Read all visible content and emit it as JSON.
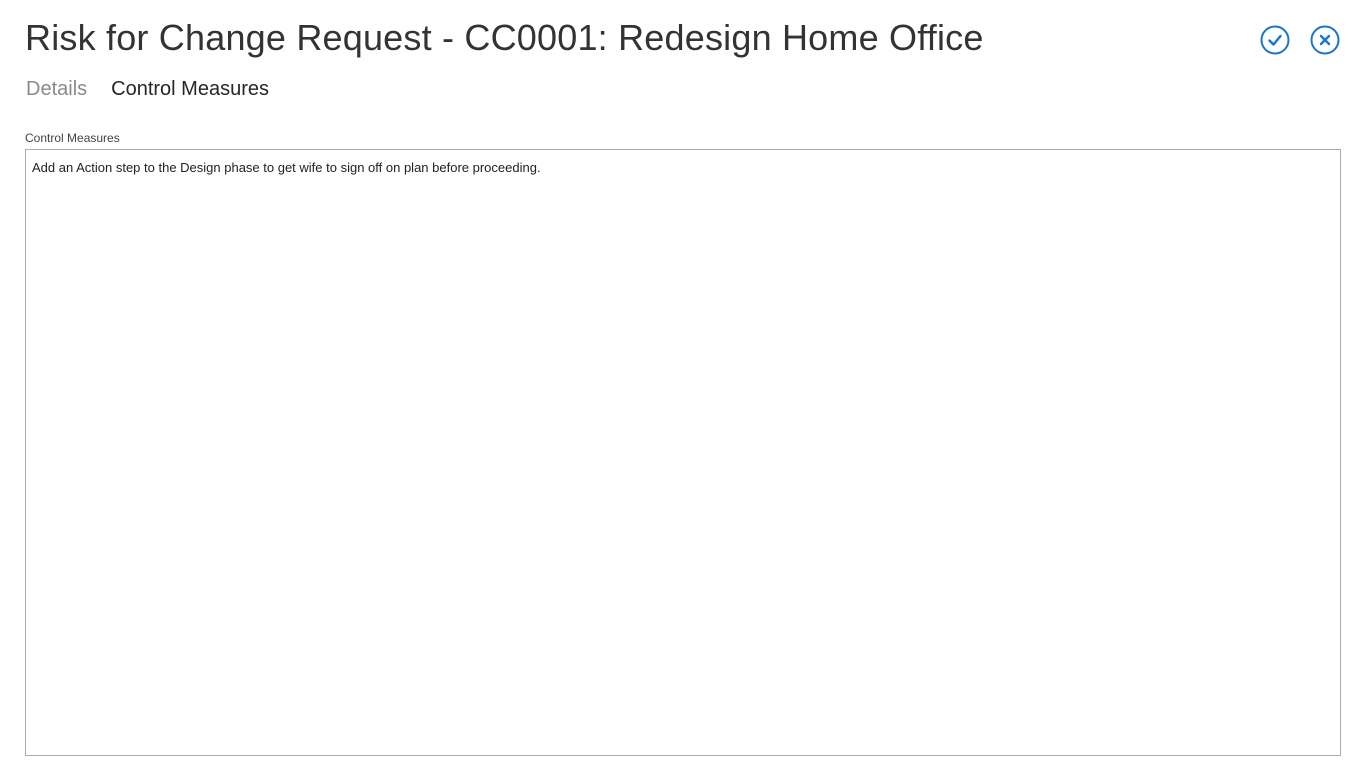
{
  "header": {
    "title": "Risk for Change Request - CC0001: Redesign Home Office"
  },
  "actions": {
    "save_icon": "check-circle-icon",
    "close_icon": "close-circle-icon",
    "accent_color": "#1976c8"
  },
  "tabs": [
    {
      "label": "Details",
      "active": false
    },
    {
      "label": "Control Measures",
      "active": true
    }
  ],
  "control_measures": {
    "label": "Control Measures",
    "value": "Add an Action step to the Design phase to get wife to sign off on plan before proceeding."
  }
}
